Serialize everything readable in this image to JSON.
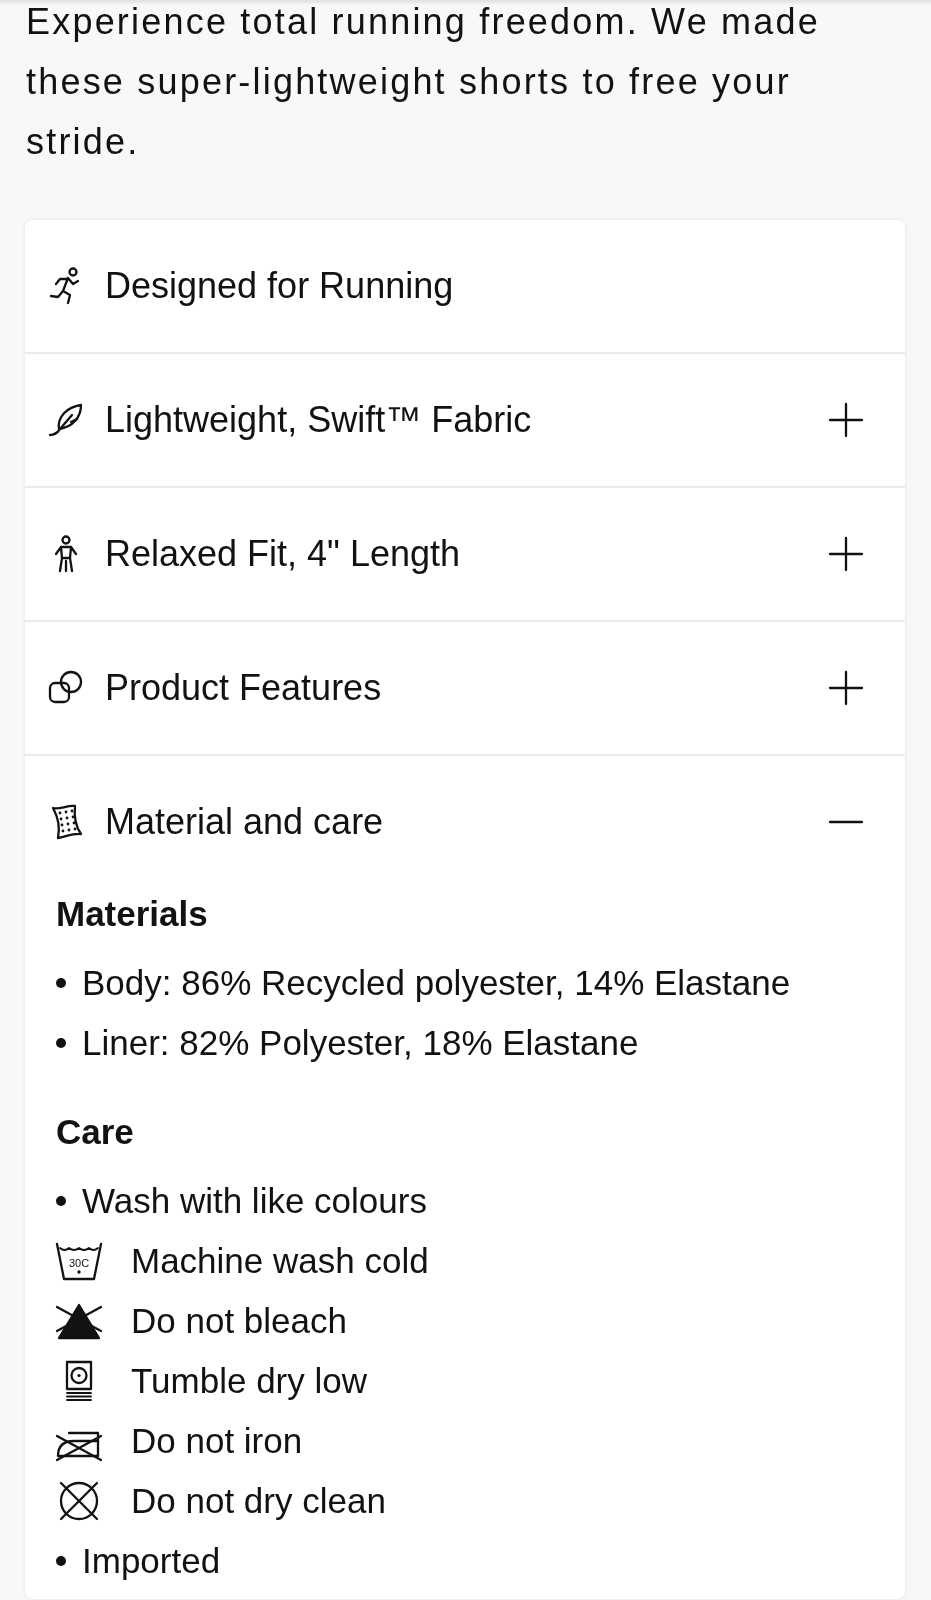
{
  "description": "Experience total running freedom. We made these super-lightweight shorts to free your stride.",
  "details": {
    "rows": [
      {
        "kind": "static",
        "title": "Designed for Running"
      },
      {
        "kind": "accordion",
        "title": "Lightweight, Swift™ Fabric",
        "expanded": false
      },
      {
        "kind": "accordion",
        "title": "Relaxed Fit, 4\" Length",
        "expanded": false
      },
      {
        "kind": "accordion",
        "title": "Product Features",
        "expanded": false
      },
      {
        "kind": "accordion",
        "title": "Material and care",
        "expanded": true,
        "sections": [
          {
            "heading": "Materials",
            "items": [
              {
                "kind": "bullet",
                "text": "Body: 86% Recycled polyester, 14% Elastane"
              },
              {
                "kind": "bullet",
                "text": "Liner: 82% Polyester, 18% Elastane"
              }
            ]
          },
          {
            "heading": "Care",
            "items": [
              {
                "kind": "bullet",
                "text": "Wash with like colours"
              },
              {
                "kind": "wash",
                "symbol_label": "30C",
                "text": "Machine wash cold"
              },
              {
                "kind": "nobleach",
                "text": "Do not bleach"
              },
              {
                "kind": "tumbledry",
                "text": "Tumble dry low"
              },
              {
                "kind": "noiron",
                "text": "Do not iron"
              },
              {
                "kind": "nodryclean",
                "text": "Do not dry clean"
              },
              {
                "kind": "bullet",
                "text": "Imported"
              }
            ]
          }
        ]
      }
    ]
  }
}
